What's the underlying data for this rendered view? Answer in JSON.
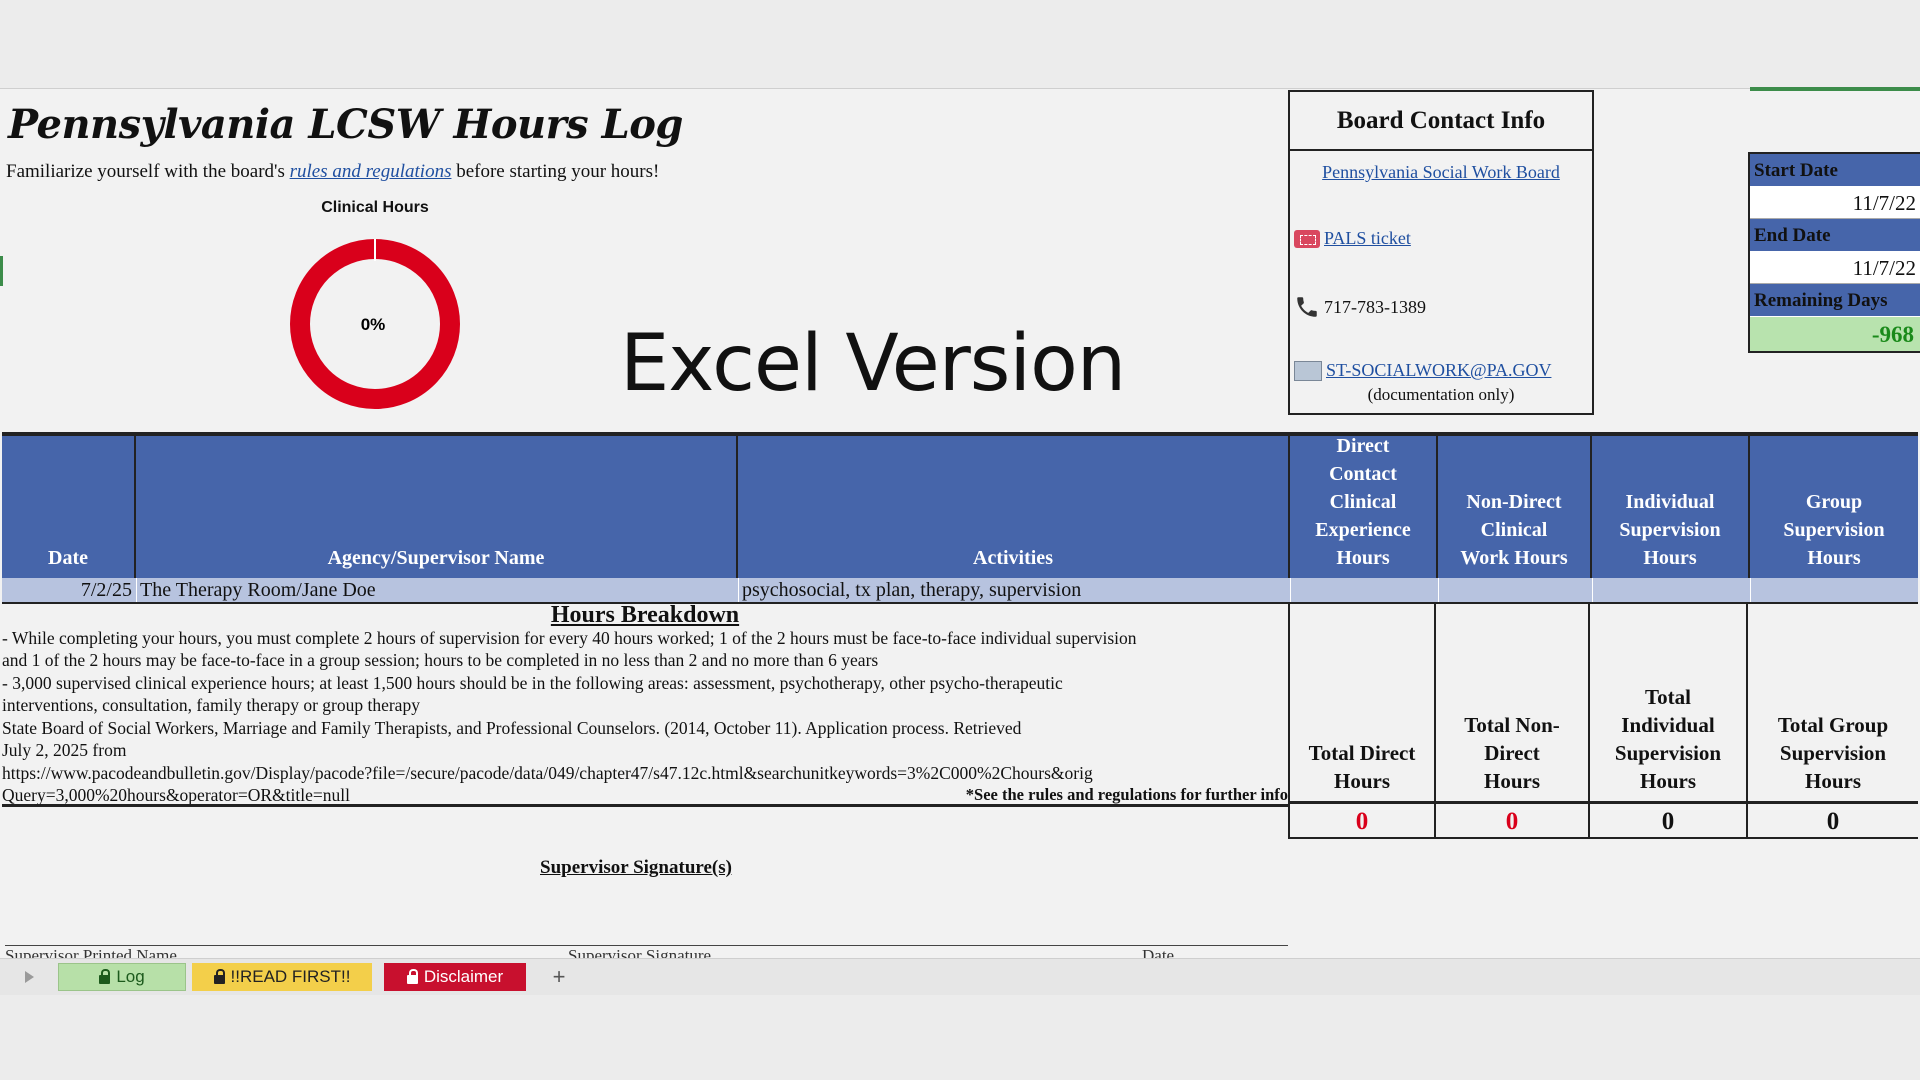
{
  "sheet": {
    "title": "Pennsylvania LCSW Hours Log",
    "subtitle_before": "Familiarize yourself with the board's",
    "subtitle_link": "rules and regulations",
    "subtitle_after": "before starting your hours!",
    "watermark": "Excel Version"
  },
  "donut": {
    "label": "Clinical Hours",
    "percent_text": "0%",
    "value": 0,
    "color": "#d9001b"
  },
  "contact": {
    "heading": "Board Contact Info",
    "board_link": "Pennsylvania Social Work Board",
    "pals": "PALS ticket",
    "phone": "717-783-1389",
    "email": "ST-SOCIALWORK@PA.GOV",
    "email_note": "(documentation only)"
  },
  "dates": {
    "start_label": "Start Date",
    "start_value": "11/7/22",
    "end_label": "End Date",
    "end_value": "11/7/22",
    "remaining_label": "Remaining Days",
    "remaining_value": "-968"
  },
  "table": {
    "headers": [
      "Date",
      "Agency/Supervisor Name",
      "Activities",
      "Direct Contact Clinical Experience Hours",
      "Non-Direct Clinical Work Hours",
      "Individual Supervision Hours",
      "Group Supervision Hours"
    ],
    "rows": [
      {
        "date": "7/2/25",
        "agency": "The Therapy Room/Jane Doe",
        "activities": "psychosocial, tx plan, therapy, supervision"
      }
    ]
  },
  "breakdown": {
    "heading": "Hours Breakdown",
    "lines": [
      "- While completing your hours, you must complete 2 hours of supervision for every 40 hours worked; 1 of the 2 hours must be face-to-face individual supervision",
      "and 1 of the 2 hours may be face-to-face in a group session; hours to be completed in no less than 2 and no more than 6 years",
      "- 3,000 supervised clinical experience hours; at least 1,500 hours should be in the following areas: assessment, psychotherapy, other psycho-therapeutic",
      "interventions, consultation, family therapy or group therapy",
      "State Board of Social Workers, Marriage and Family Therapists, and Professional Counselors. (2014, October 11). Application process. Retrieved",
      "July 2, 2025 from",
      "https://www.pacodeandbulletin.gov/Display/pacode?file=/secure/pacode/data/049/chapter47/s47.12c.html&searchunitkeywords=3%2C000%2Chours&orig",
      "Query=3,000%20hours&operator=OR&title=null"
    ],
    "note": "*See the rules and regulations for further info"
  },
  "totals": {
    "labels": [
      "Total Direct Hours",
      "Total Non-Direct Hours",
      "Total Individual Supervision Hours",
      "Total Group Supervision Hours"
    ],
    "values": [
      "0",
      "0",
      "0",
      "0"
    ]
  },
  "signature": {
    "heading": "Supervisor Signature(s)",
    "printed_name": "Supervisor Printed Name",
    "sig": "Supervisor Signature",
    "date": "Date"
  },
  "tabs": [
    {
      "label": "Log",
      "bg": "#b7e0a8",
      "fg": "#1c5a1c"
    },
    {
      "label": "!!READ FIRST!!",
      "bg": "#f3cf4a",
      "fg": "#222222"
    },
    {
      "label": "Disclaimer",
      "bg": "#c8102e",
      "fg": "#ffffff"
    }
  ],
  "add_tab": "+"
}
